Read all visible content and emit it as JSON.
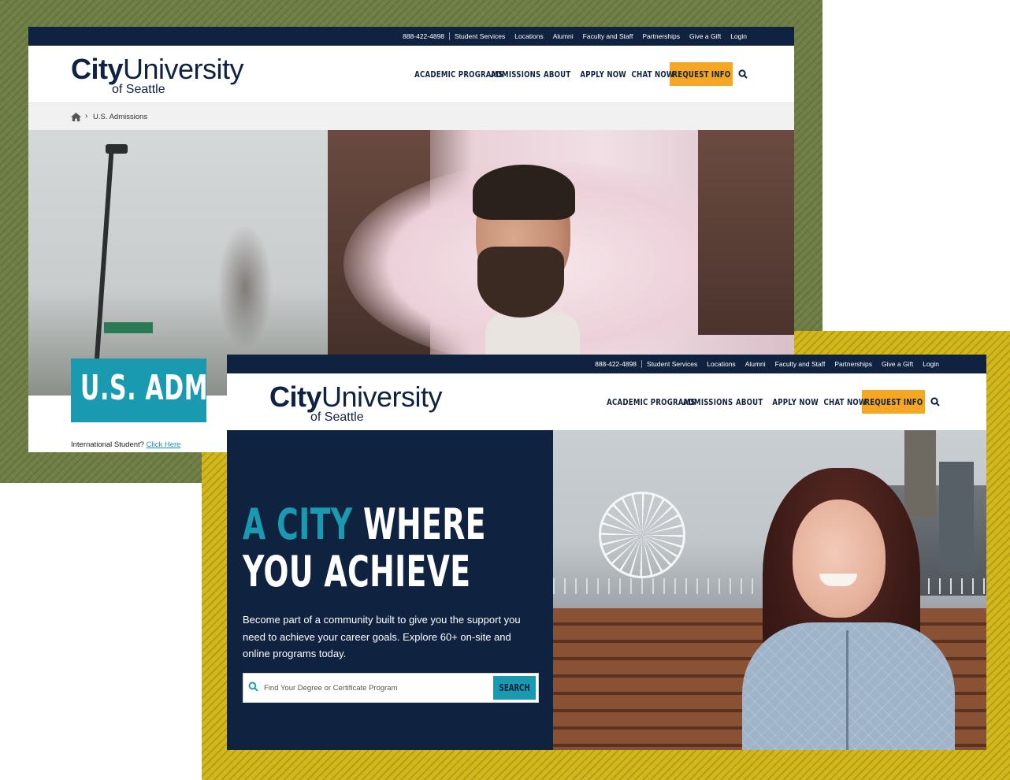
{
  "utility_nav": [
    "888-422-4898",
    "Student Services",
    "Locations",
    "Alumni",
    "Faculty and Staff",
    "Partnerships",
    "Give a Gift",
    "Login"
  ],
  "logo": {
    "city": "City",
    "university": "University",
    "sub": "of Seattle"
  },
  "main_nav": {
    "items": [
      "ACADEMIC PROGRAMS",
      "ADMISSIONS",
      "ABOUT",
      "APPLY NOW",
      "CHAT NOW"
    ],
    "request_info": "REQUEST INFO",
    "search_icon": "search-icon"
  },
  "page1": {
    "breadcrumb_current": "U.S. Admissions",
    "hero_title": "U.S. ADMIS",
    "intl_text": "International Student?",
    "intl_link": "Click Here"
  },
  "page2": {
    "headline_teal": "A CITY",
    "headline_white1": "WHERE",
    "headline_white2": "YOU ACHIEVE",
    "subtext": "Become part of a community built to give you the support you need to achieve your career goals. Explore 60+ on-site and online programs today.",
    "search_placeholder": "Find Your Degree or Certificate Program",
    "search_button": "SEARCH"
  },
  "colors": {
    "navy": "#0f2340",
    "teal": "#1a9ab0",
    "orange": "#f5a623",
    "olive_bg": "#6f7f45",
    "mustard_bg": "#d1b71a"
  }
}
